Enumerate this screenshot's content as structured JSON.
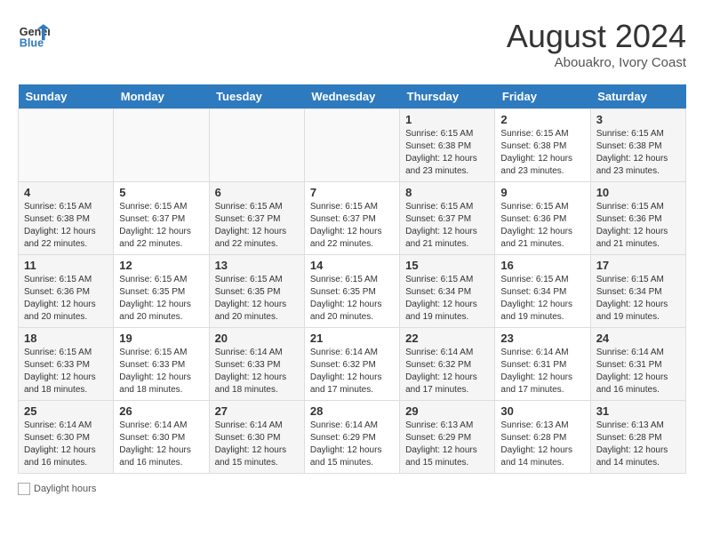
{
  "header": {
    "logo_line1": "General",
    "logo_line2": "Blue",
    "month_year": "August 2024",
    "location": "Abouakro, Ivory Coast"
  },
  "days_of_week": [
    "Sunday",
    "Monday",
    "Tuesday",
    "Wednesday",
    "Thursday",
    "Friday",
    "Saturday"
  ],
  "weeks": [
    [
      {
        "day": "",
        "info": ""
      },
      {
        "day": "",
        "info": ""
      },
      {
        "day": "",
        "info": ""
      },
      {
        "day": "",
        "info": ""
      },
      {
        "day": "1",
        "info": "Sunrise: 6:15 AM\nSunset: 6:38 PM\nDaylight: 12 hours\nand 23 minutes."
      },
      {
        "day": "2",
        "info": "Sunrise: 6:15 AM\nSunset: 6:38 PM\nDaylight: 12 hours\nand 23 minutes."
      },
      {
        "day": "3",
        "info": "Sunrise: 6:15 AM\nSunset: 6:38 PM\nDaylight: 12 hours\nand 23 minutes."
      }
    ],
    [
      {
        "day": "4",
        "info": "Sunrise: 6:15 AM\nSunset: 6:38 PM\nDaylight: 12 hours\nand 22 minutes."
      },
      {
        "day": "5",
        "info": "Sunrise: 6:15 AM\nSunset: 6:37 PM\nDaylight: 12 hours\nand 22 minutes."
      },
      {
        "day": "6",
        "info": "Sunrise: 6:15 AM\nSunset: 6:37 PM\nDaylight: 12 hours\nand 22 minutes."
      },
      {
        "day": "7",
        "info": "Sunrise: 6:15 AM\nSunset: 6:37 PM\nDaylight: 12 hours\nand 22 minutes."
      },
      {
        "day": "8",
        "info": "Sunrise: 6:15 AM\nSunset: 6:37 PM\nDaylight: 12 hours\nand 21 minutes."
      },
      {
        "day": "9",
        "info": "Sunrise: 6:15 AM\nSunset: 6:36 PM\nDaylight: 12 hours\nand 21 minutes."
      },
      {
        "day": "10",
        "info": "Sunrise: 6:15 AM\nSunset: 6:36 PM\nDaylight: 12 hours\nand 21 minutes."
      }
    ],
    [
      {
        "day": "11",
        "info": "Sunrise: 6:15 AM\nSunset: 6:36 PM\nDaylight: 12 hours\nand 20 minutes."
      },
      {
        "day": "12",
        "info": "Sunrise: 6:15 AM\nSunset: 6:35 PM\nDaylight: 12 hours\nand 20 minutes."
      },
      {
        "day": "13",
        "info": "Sunrise: 6:15 AM\nSunset: 6:35 PM\nDaylight: 12 hours\nand 20 minutes."
      },
      {
        "day": "14",
        "info": "Sunrise: 6:15 AM\nSunset: 6:35 PM\nDaylight: 12 hours\nand 20 minutes."
      },
      {
        "day": "15",
        "info": "Sunrise: 6:15 AM\nSunset: 6:34 PM\nDaylight: 12 hours\nand 19 minutes."
      },
      {
        "day": "16",
        "info": "Sunrise: 6:15 AM\nSunset: 6:34 PM\nDaylight: 12 hours\nand 19 minutes."
      },
      {
        "day": "17",
        "info": "Sunrise: 6:15 AM\nSunset: 6:34 PM\nDaylight: 12 hours\nand 19 minutes."
      }
    ],
    [
      {
        "day": "18",
        "info": "Sunrise: 6:15 AM\nSunset: 6:33 PM\nDaylight: 12 hours\nand 18 minutes."
      },
      {
        "day": "19",
        "info": "Sunrise: 6:15 AM\nSunset: 6:33 PM\nDaylight: 12 hours\nand 18 minutes."
      },
      {
        "day": "20",
        "info": "Sunrise: 6:14 AM\nSunset: 6:33 PM\nDaylight: 12 hours\nand 18 minutes."
      },
      {
        "day": "21",
        "info": "Sunrise: 6:14 AM\nSunset: 6:32 PM\nDaylight: 12 hours\nand 17 minutes."
      },
      {
        "day": "22",
        "info": "Sunrise: 6:14 AM\nSunset: 6:32 PM\nDaylight: 12 hours\nand 17 minutes."
      },
      {
        "day": "23",
        "info": "Sunrise: 6:14 AM\nSunset: 6:31 PM\nDaylight: 12 hours\nand 17 minutes."
      },
      {
        "day": "24",
        "info": "Sunrise: 6:14 AM\nSunset: 6:31 PM\nDaylight: 12 hours\nand 16 minutes."
      }
    ],
    [
      {
        "day": "25",
        "info": "Sunrise: 6:14 AM\nSunset: 6:30 PM\nDaylight: 12 hours\nand 16 minutes."
      },
      {
        "day": "26",
        "info": "Sunrise: 6:14 AM\nSunset: 6:30 PM\nDaylight: 12 hours\nand 16 minutes."
      },
      {
        "day": "27",
        "info": "Sunrise: 6:14 AM\nSunset: 6:30 PM\nDaylight: 12 hours\nand 15 minutes."
      },
      {
        "day": "28",
        "info": "Sunrise: 6:14 AM\nSunset: 6:29 PM\nDaylight: 12 hours\nand 15 minutes."
      },
      {
        "day": "29",
        "info": "Sunrise: 6:13 AM\nSunset: 6:29 PM\nDaylight: 12 hours\nand 15 minutes."
      },
      {
        "day": "30",
        "info": "Sunrise: 6:13 AM\nSunset: 6:28 PM\nDaylight: 12 hours\nand 14 minutes."
      },
      {
        "day": "31",
        "info": "Sunrise: 6:13 AM\nSunset: 6:28 PM\nDaylight: 12 hours\nand 14 minutes."
      }
    ]
  ],
  "legend": {
    "daylight_label": "Daylight hours"
  }
}
